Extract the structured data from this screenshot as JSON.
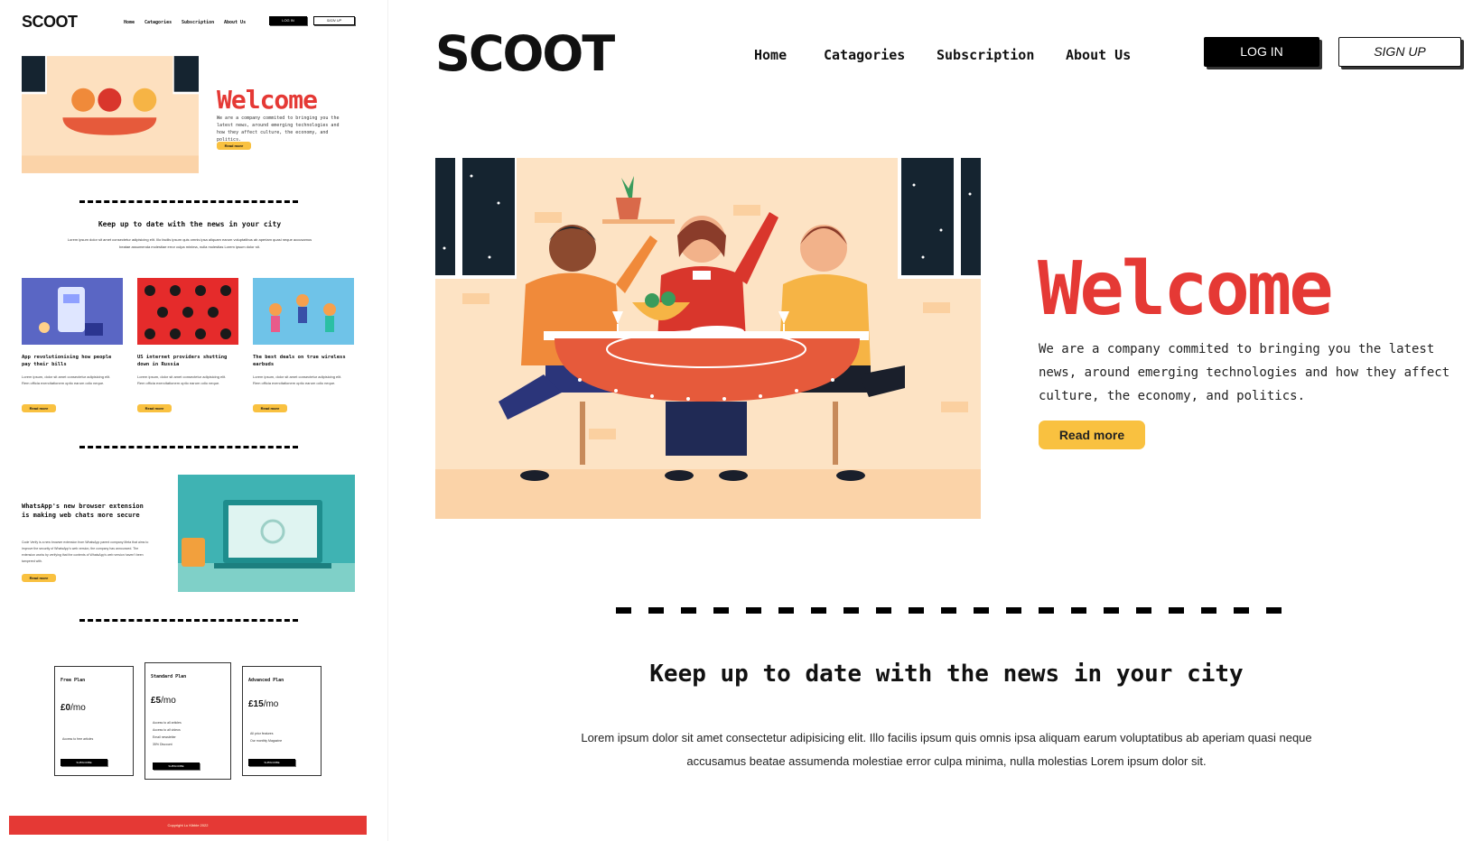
{
  "brand": {
    "logo": "SCOOT"
  },
  "nav": {
    "items": [
      "Home",
      "Catagories",
      "Subscription",
      "About Us"
    ],
    "login_label": "LOG IN",
    "signup_label": "SIGN UP"
  },
  "hero": {
    "title": "Welcome",
    "text": "We are a company commited to bringing you the latest news, around emerging technologies and how they affect culture, the economy, and politics.",
    "read_more_label": "Read more"
  },
  "news_section": {
    "title": "Keep up to date with the news in your city",
    "text": "Lorem ipsum dolor sit amet consectetur adipisicing elit. Illo facilis ipsum quis omnis ipsa aliquam earum voluptatibus ab aperiam quasi neque accusamus beatae assumenda molestiae error culpa minima, nulla molestias Lorem ipsum dolor sit."
  },
  "thumbnail": {
    "hero_text": "We are a company commited to bringing you the latest news, around emerging technologies and how they affect culture, the economy, and politics.",
    "cards": [
      {
        "title": "App revolutionising how people pay their bills",
        "body": "Lorem ipsum, dolor sit amet consectetur adipisicing elit. Rem officia exercitationem optio earum odio neque.",
        "read_more": "Read more"
      },
      {
        "title": "US internet providers shutting down in Russia",
        "body": "Lorem ipsum, dolor sit amet consectetur adipisicing elit. Rem officia exercitationem optio earum odio neque.",
        "read_more": "Read more"
      },
      {
        "title": "The best deals on true wireless earbuds",
        "body": "Lorem ipsum, dolor sit amet consectetur adipisicing elit. Rem officia exercitationem optio earum odio neque.",
        "read_more": "Read more"
      }
    ],
    "feature": {
      "title": "WhatsApp's new browser extension is making web chats more secure",
      "body": "Code Verify is a new browser extension from WhatsApp parent company Meta that aims to improve the security of WhatsApp's web version, the company has announced. The extension works by verifying that the contents of WhatsApp's web version haven't been tampered with.",
      "read_more": "Read more"
    },
    "plans": [
      {
        "name": "Free Plan",
        "price": "£0",
        "period": "/mo",
        "features": [
          "Access to free articles"
        ],
        "button": "SUBSCRIBE"
      },
      {
        "name": "Standard Plan",
        "price": "£5",
        "period": "/mo",
        "features": [
          "Access to all articles",
          "Access to all videos",
          "Email newsletter",
          "35% Discount"
        ],
        "button": "SUBSCRIBE"
      },
      {
        "name": "Advanced Plan",
        "price": "£15",
        "period": "/mo",
        "features": [
          "All prior features",
          "Our monthly Magazine"
        ],
        "button": "SUBSCRIBE"
      }
    ],
    "footer": "Copyright Lu Kibble 2022"
  },
  "colors": {
    "accent_red": "#e53935",
    "button_yellow": "#f9c140"
  }
}
